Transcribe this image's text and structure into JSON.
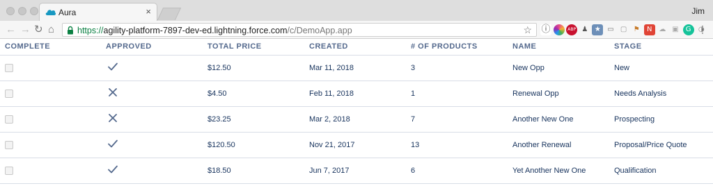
{
  "browser": {
    "tab_title": "Aura",
    "tab_close": "×",
    "user": "Jim",
    "url": {
      "scheme": "https://",
      "host": "agility-platform-7897-dev-ed.lightning.force.com",
      "path": "/c/DemoApp.app"
    },
    "nav": {
      "back": "←",
      "forward": "→",
      "reload": "↻",
      "home": "⌂"
    },
    "star": "☆",
    "menu": "⋮",
    "extensions": [
      {
        "name": "info-icon",
        "glyph": "ⓘ",
        "color": "#ffffff",
        "fg": "#555555"
      },
      {
        "name": "color-wheel-icon",
        "glyph": "",
        "color": "#e84c88",
        "fg": "#ffffff"
      },
      {
        "name": "adblock-icon",
        "glyph": "ABP",
        "color": "#c8102e",
        "fg": "#ffffff"
      },
      {
        "name": "person-icon",
        "glyph": "♟",
        "color": "#f6f6f6",
        "fg": "#555555"
      },
      {
        "name": "box-icon",
        "glyph": "★",
        "color": "#6d8fb8",
        "fg": "#ffffff"
      },
      {
        "name": "card-icon",
        "glyph": "▭",
        "color": "#f6f6f6",
        "fg": "#777777"
      },
      {
        "name": "folder-icon",
        "glyph": "▢",
        "color": "#f6f6f6",
        "fg": "#999999"
      },
      {
        "name": "flag-icon",
        "glyph": "⚑",
        "color": "#f6f6f6",
        "fg": "#c77b2a"
      },
      {
        "name": "n-icon",
        "glyph": "N",
        "color": "#e04436",
        "fg": "#ffffff"
      },
      {
        "name": "cloud-icon",
        "glyph": "☁",
        "color": "#f6f6f6",
        "fg": "#aaaaaa"
      },
      {
        "name": "puzzle-icon",
        "glyph": "▣",
        "color": "#f6f6f6",
        "fg": "#aaaaaa"
      },
      {
        "name": "grammarly-icon",
        "glyph": "G",
        "color": "#15c39a",
        "fg": "#ffffff"
      },
      {
        "name": "toggle-icon",
        "glyph": "◑",
        "color": "#f6f6f6",
        "fg": "#888888"
      }
    ]
  },
  "table": {
    "headers": [
      "COMPLETE",
      "APPROVED",
      "TOTAL PRICE",
      "CREATED",
      "# OF PRODUCTS",
      "NAME",
      "STAGE"
    ],
    "rows": [
      {
        "complete": false,
        "approved": true,
        "total_price": "$12.50",
        "created": "Mar 11, 2018",
        "products": "3",
        "name": "New Opp",
        "stage": "New"
      },
      {
        "complete": false,
        "approved": false,
        "total_price": "$4.50",
        "created": "Feb 11, 2018",
        "products": "1",
        "name": "Renewal Opp",
        "stage": "Needs Analysis"
      },
      {
        "complete": false,
        "approved": false,
        "total_price": "$23.25",
        "created": "Mar 2, 2018",
        "products": "7",
        "name": "Another New One",
        "stage": "Prospecting"
      },
      {
        "complete": false,
        "approved": true,
        "total_price": "$120.50",
        "created": "Nov 21, 2017",
        "products": "13",
        "name": "Another Renewal",
        "stage": "Proposal/Price Quote"
      },
      {
        "complete": false,
        "approved": true,
        "total_price": "$18.50",
        "created": "Jun 7, 2017",
        "products": "6",
        "name": "Yet Another New One",
        "stage": "Qualification"
      }
    ]
  },
  "colors": {
    "header_text": "#54698d",
    "cell_text": "#16325c",
    "divider": "#d8dde6",
    "icon": "#54698d"
  }
}
